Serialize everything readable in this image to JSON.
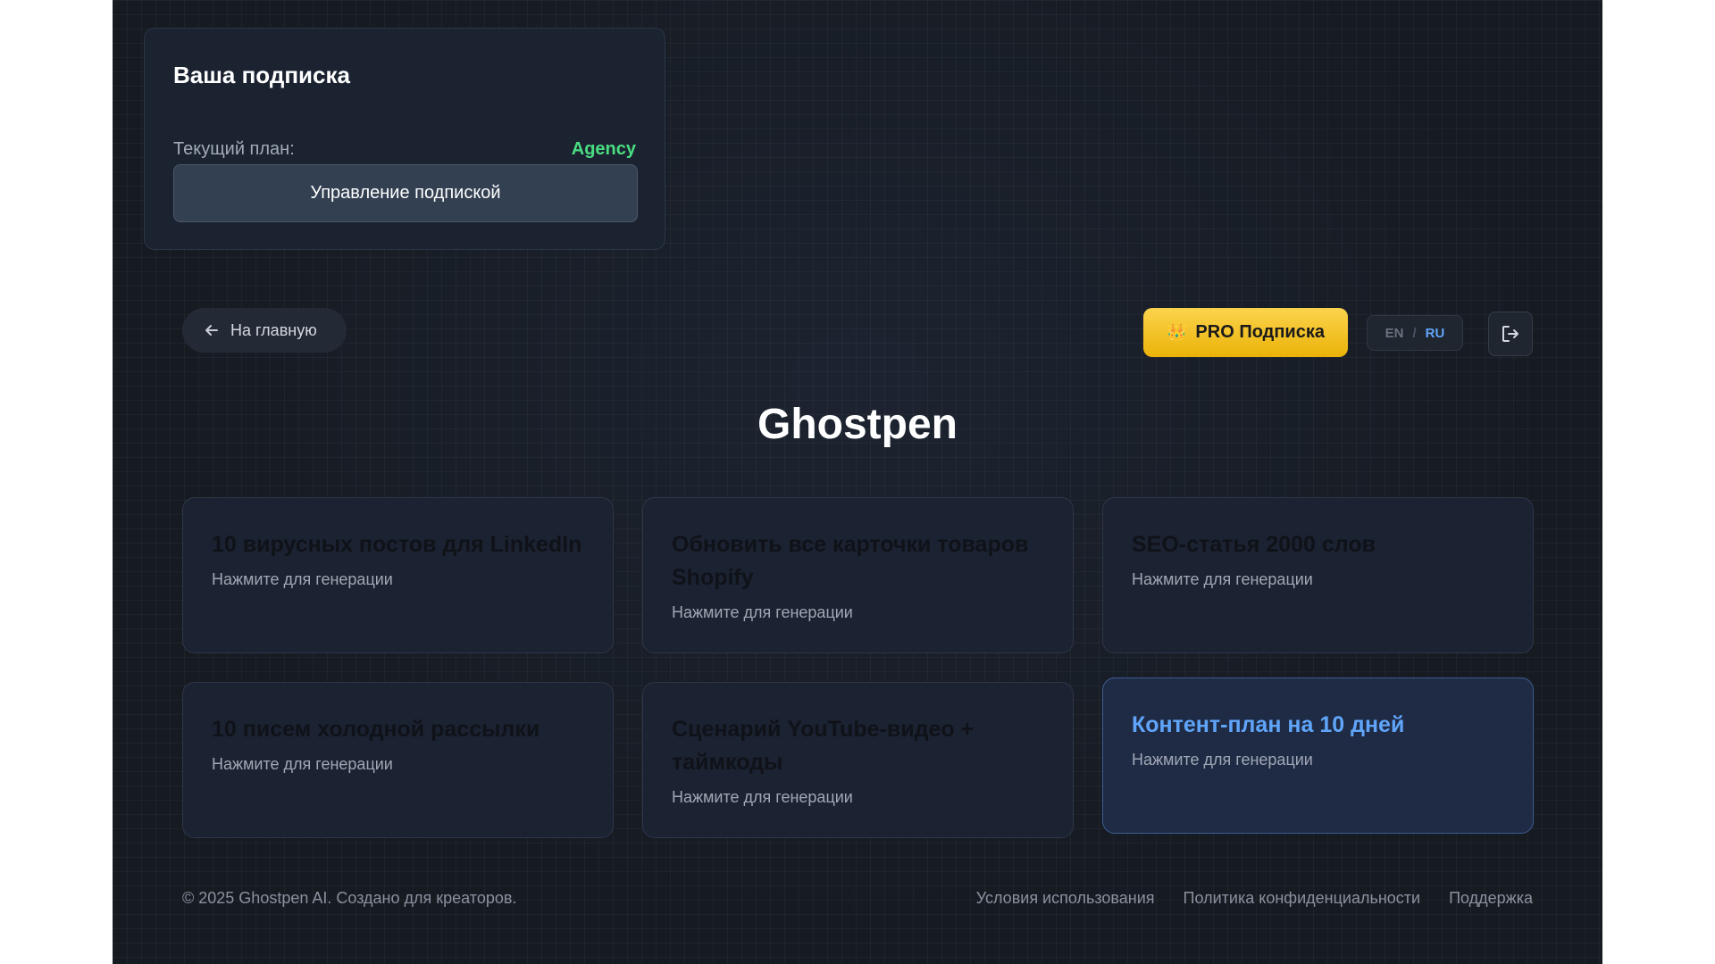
{
  "subscription": {
    "title": "Ваша подписка",
    "plan_label": "Текущий план:",
    "plan_value": "Agency",
    "manage_label": "Управление подпиской"
  },
  "nav": {
    "back_label": "На главную",
    "pro_label": "PRO Подписка",
    "lang_en": "EN",
    "lang_sep": "/",
    "lang_ru": "RU",
    "active_lang": "RU"
  },
  "brand": "Ghostpen",
  "cards": [
    {
      "title": "10 вирусных постов для LinkedIn",
      "subtitle": "Нажмите для генерации"
    },
    {
      "title": "Обновить все карточки товаров Shopify",
      "subtitle": "Нажмите для генерации"
    },
    {
      "title": "SEO-статья 2000 слов",
      "subtitle": "Нажмите для генерации"
    },
    {
      "title": "10 писем холодной рассылки",
      "subtitle": "Нажмите для генерации"
    },
    {
      "title": "Сценарий YouTube-видео + таймкоды",
      "subtitle": "Нажмите для генерации"
    },
    {
      "title": "Контент-план на 10 дней",
      "subtitle": "Нажмите для генерации"
    }
  ],
  "footer": {
    "copyright": "© 2025 Ghostpen AI. Создано для креаторов.",
    "links": [
      "Условия использования",
      "Политика конфиденциальности",
      "Поддержка"
    ]
  },
  "colors": {
    "accent": "#60a5fa",
    "plan_green": "#4ade80",
    "pro_gold": "#fbbf24"
  },
  "icons": {
    "back": "arrow-left-icon",
    "pro": "crown-icon",
    "logout": "logout-icon"
  }
}
